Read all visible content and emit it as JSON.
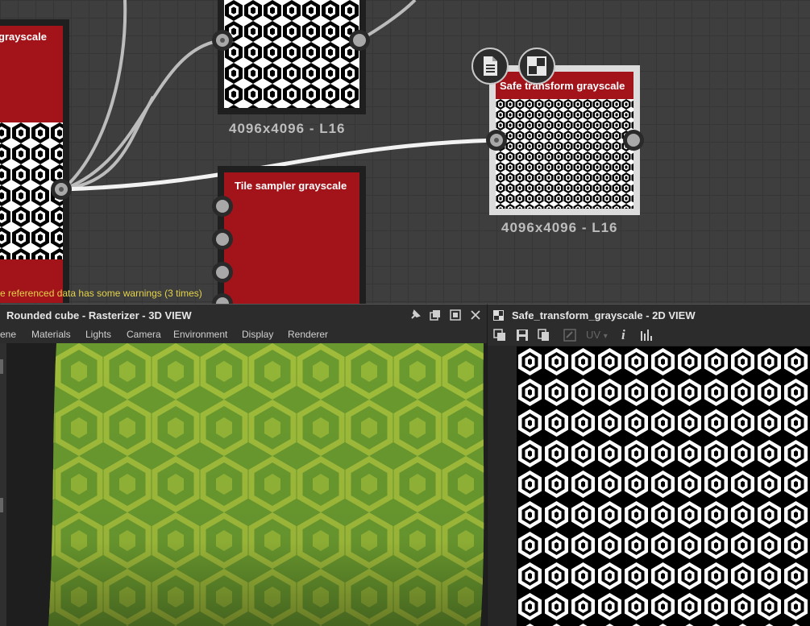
{
  "graph": {
    "nodes": {
      "left_node_title": "grayscale",
      "top_node_resolution": "4096x4096 - L16",
      "tile_sampler_title": "Tile sampler grayscale",
      "safe_transform_title": "Safe transform grayscale",
      "safe_transform_resolution": "4096x4096 - L16"
    },
    "warning_text": "e referenced data has some warnings (3 times)",
    "badges": [
      "document-icon",
      "checker-icon"
    ],
    "colors": {
      "node_header": "#a2131a",
      "wire": "#f2f2f2",
      "wire_dim": "#bcbcbc"
    }
  },
  "view3d": {
    "title": "Rounded cube - Rasterizer - 3D VIEW",
    "menu": [
      "ene",
      "Materials",
      "Lights",
      "Camera",
      "Environment",
      "Display",
      "Renderer"
    ],
    "header_icons": [
      "pin-icon",
      "restore-icon",
      "maximize-icon",
      "close-icon"
    ]
  },
  "view2d": {
    "title": "Safe_transform_grayscale - 2D VIEW",
    "toolbar": {
      "uv_label": "UV",
      "uv_arrow": "▾",
      "info_label": "i"
    }
  }
}
